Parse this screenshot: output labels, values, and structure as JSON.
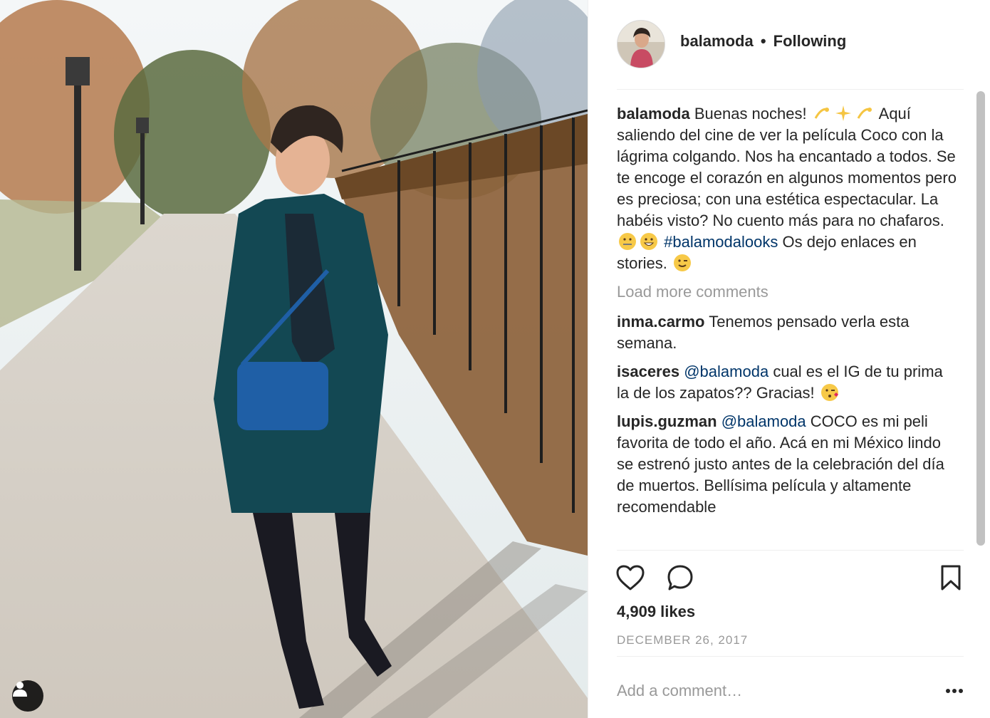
{
  "post": {
    "username": "balamoda",
    "separator": "•",
    "follow_status": "Following",
    "caption": {
      "username": "balamoda",
      "text_1": "Buenas noches!",
      "text_2": "Aquí saliendo del cine de ver la película Coco con la lágrima colgando. Nos ha encantado a todos. Se te encoge el corazón en algunos momentos pero es preciosa; con una estética espectacular. La habéis visto? No cuento más para no chafaros.",
      "hashtag": "#balamodalooks",
      "text_3": "Os dejo enlaces en stories."
    },
    "load_more": "Load more comments",
    "comments": [
      {
        "username": "inma.carmo",
        "mention": "",
        "text": "Tenemos pensado verla esta semana."
      },
      {
        "username": "isaceres",
        "mention": "@balamoda",
        "text": "cual es el IG de tu prima la de los zapatos?? Gracias!"
      },
      {
        "username": "lupis.guzman",
        "mention": "@balamoda",
        "text": "COCO es mi peli favorita de todo el año. Acá en mi México lindo se estrenó justo antes de la celebración del día de muertos. Bellísima película y altamente recomendable"
      }
    ],
    "likes": "4,909 likes",
    "date": "DECEMBER 26, 2017",
    "add_comment_placeholder": "Add a comment…"
  },
  "icons": {
    "like": "heart-outline-icon",
    "comment": "speech-bubble-icon",
    "save": "bookmark-icon",
    "more": "ellipsis-icon",
    "tagged": "person-icon"
  },
  "colors": {
    "text": "#262626",
    "muted": "#999999",
    "link": "#003569",
    "divider": "#efefef"
  }
}
